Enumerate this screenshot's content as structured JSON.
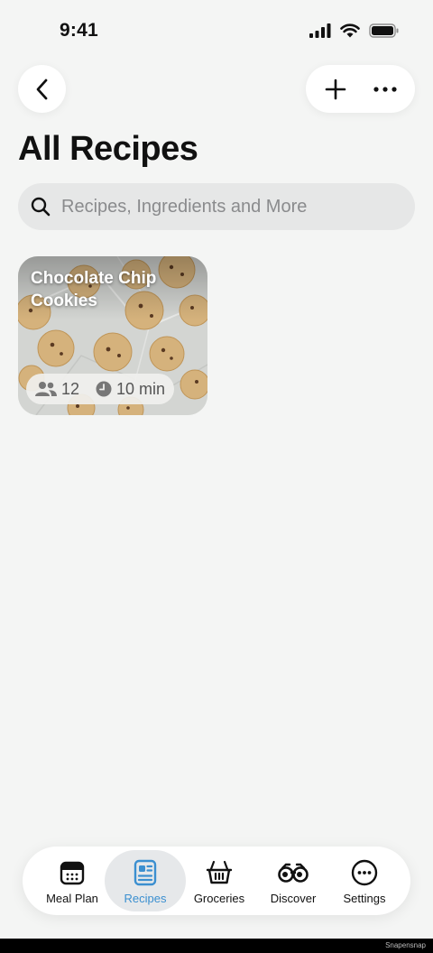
{
  "status": {
    "time": "9:41"
  },
  "header": {
    "title": "All Recipes"
  },
  "search": {
    "placeholder": "Recipes, Ingredients and More"
  },
  "recipes": [
    {
      "title": "Chocolate Chip Cookies",
      "servings": "12",
      "time": "10 min"
    }
  ],
  "tabs": [
    {
      "label": "Meal Plan",
      "icon": "calendar-icon",
      "active": false
    },
    {
      "label": "Recipes",
      "icon": "recipe-card-icon",
      "active": true
    },
    {
      "label": "Groceries",
      "icon": "basket-icon",
      "active": false
    },
    {
      "label": "Discover",
      "icon": "binoculars-icon",
      "active": false
    },
    {
      "label": "Settings",
      "icon": "more-circle-icon",
      "active": false
    }
  ],
  "colors": {
    "accent": "#3b8fd0",
    "background": "#f4f5f4"
  },
  "watermark": "Snapensnap"
}
